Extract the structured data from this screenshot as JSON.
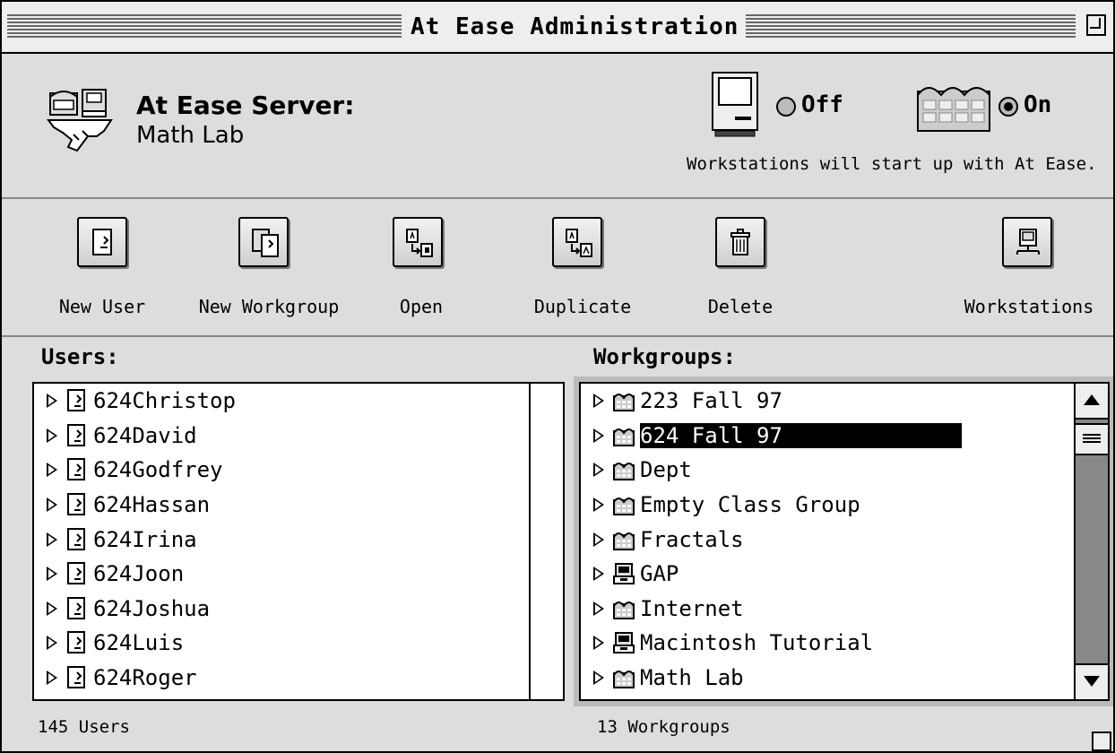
{
  "window": {
    "title": "At Ease Administration"
  },
  "server": {
    "label": "At Ease Server:",
    "name": "Math Lab"
  },
  "startup": {
    "off_label": "Off",
    "on_label": "On",
    "selected": "On",
    "note": "Workstations will start up with At Ease."
  },
  "toolbar": [
    {
      "label": "New User",
      "icon": "user-icon"
    },
    {
      "label": "New Workgroup",
      "icon": "workgroup-icon"
    },
    {
      "label": "Open",
      "icon": "open-icon"
    },
    {
      "label": "Duplicate",
      "icon": "duplicate-icon"
    },
    {
      "label": "Delete",
      "icon": "trash-icon"
    },
    {
      "label": "Workstations",
      "icon": "workstation-icon"
    }
  ],
  "users": {
    "header": "Users:",
    "items": [
      "624Christop",
      "624David",
      "624Godfrey",
      "624Hassan",
      "624Irina",
      "624Joon",
      "624Joshua",
      "624Luis",
      "624Roger"
    ],
    "count": "145 Users"
  },
  "workgroups": {
    "header": "Workgroups:",
    "items": [
      {
        "name": "223 Fall 97",
        "icon": "folder-icon"
      },
      {
        "name": "624 Fall 97",
        "icon": "folder-icon",
        "selected": true
      },
      {
        "name": "Dept",
        "icon": "folder-icon"
      },
      {
        "name": "Empty Class Group",
        "icon": "folder-icon"
      },
      {
        "name": "Fractals",
        "icon": "folder-icon"
      },
      {
        "name": "GAP",
        "icon": "server-icon"
      },
      {
        "name": "Internet",
        "icon": "folder-icon"
      },
      {
        "name": "Macintosh Tutorial",
        "icon": "server-icon"
      },
      {
        "name": "Math Lab",
        "icon": "folder-icon"
      }
    ],
    "count": "13 Workgroups"
  }
}
